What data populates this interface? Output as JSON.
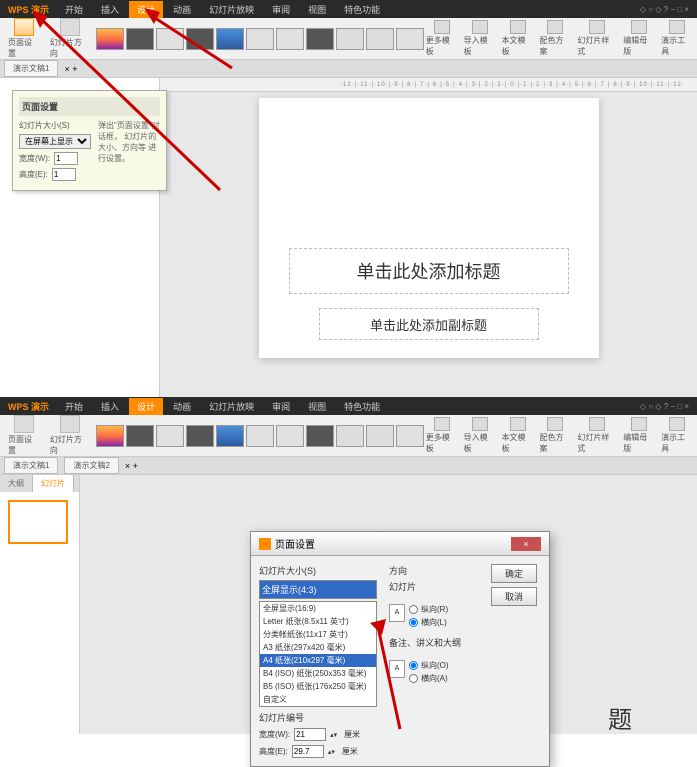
{
  "app_name": "WPS 演示",
  "menu": {
    "items": [
      "开始",
      "插入",
      "设计",
      "动画",
      "幻灯片放映",
      "审阅",
      "视图",
      "特色功能"
    ]
  },
  "ribbon": {
    "page_setup": "页面设置",
    "slide_orient": "幻灯片方向",
    "more_templates": "更多模板",
    "import_template": "导入模板",
    "this_template": "本文模板",
    "color_scheme": "配色方案",
    "slide_style": "幻灯片样式",
    "edit_master": "编辑母版",
    "present_tools": "演示工具"
  },
  "doc_tabs": [
    "演示文稿1",
    "演示文稿2"
  ],
  "side_tabs": [
    "大纲",
    "幻灯片"
  ],
  "tooltip": {
    "title": "页面设置",
    "desc1": "弹出\"页面设置\"对话框，",
    "desc2": "幻灯片的大小、方向等",
    "desc3": "进行设置。",
    "size_label": "幻灯片大小(S)",
    "screen_show": "在屏幕上显示",
    "width_label": "宽度(W):",
    "height_label": "高度(E):",
    "width_val": "1",
    "height_val": "1"
  },
  "ruler": "·12·|·11·|·10·|·9·|·8·|·7·|·6·|·5·|·4·|·3·|·2·|·1·|·0·|·1·|·2·|·3·|·4·|·5·|·6·|·7·|·8·|·9·|·10·|·11·|·12·",
  "slide": {
    "title_placeholder": "单击此处添加标题",
    "subtitle_placeholder": "单击此处添加副标题"
  },
  "dialog": {
    "title": "页面设置",
    "size_label": "幻灯片大小(S)",
    "orient_label": "方向",
    "slide_label": "幻灯片",
    "ok": "确定",
    "cancel": "取消",
    "portrait": "纵向(R)",
    "landscape": "横向(L)",
    "notes_label": "备注、讲义和大纲",
    "portrait2": "纵向(O)",
    "landscape2": "横向(A)",
    "width_label": "宽度(W):",
    "height_label": "高度(E):",
    "width_val": "21",
    "height_val": "29.7",
    "unit": "厘米",
    "start_num": "幻灯片编号",
    "options": [
      "全屏显示(4:3)",
      "全屏显示(16:9)",
      "Letter 纸张(8.5x11 英寸)",
      "分类帐纸张(11x17 英寸)",
      "A3 纸张(297x420 毫米)",
      "A4 纸张(210x297 毫米)",
      "B4 (ISO) 纸张(250x353 毫米)",
      "B5 (ISO) 纸张(176x250 毫米)",
      "自定义"
    ]
  },
  "big_title_partial": "题",
  "win_controls": "◇ ○ ◇ ? − □ ×"
}
